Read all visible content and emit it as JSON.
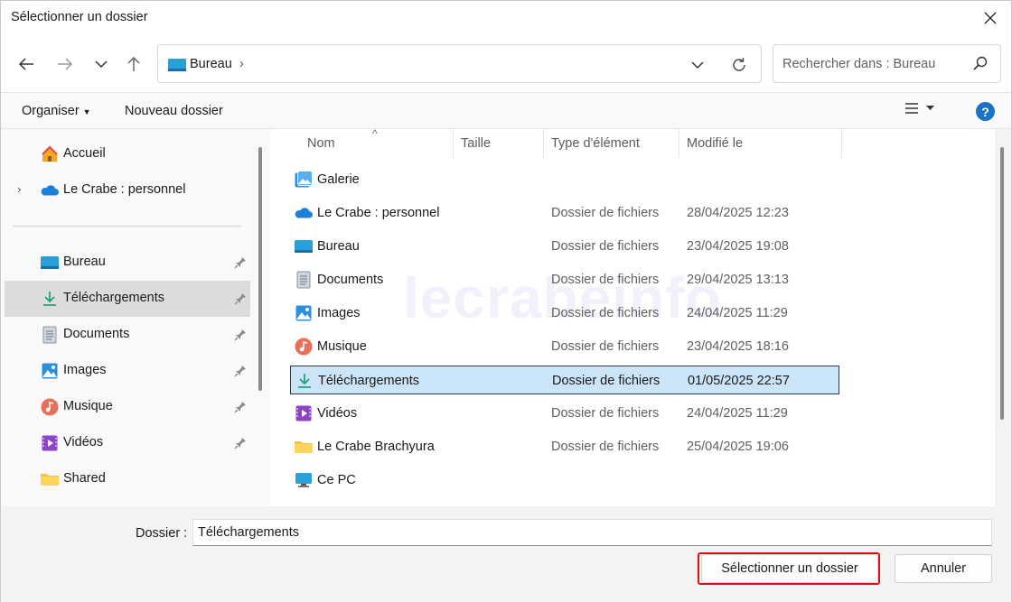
{
  "window": {
    "title": "Sélectionner un dossier"
  },
  "address": {
    "crumb": "Bureau",
    "separator": "›"
  },
  "search": {
    "placeholder": "Rechercher dans : Bureau"
  },
  "toolbar": {
    "organize_label": "Organiser",
    "new_folder_label": "Nouveau dossier",
    "help_label": "?"
  },
  "sidebar": {
    "items": [
      {
        "label": "Accueil",
        "icon": "home-icon"
      },
      {
        "label": "Le Crabe : personnel",
        "icon": "onedrive-icon"
      },
      {
        "label": "Bureau",
        "icon": "desktop-icon",
        "pinned": true
      },
      {
        "label": "Téléchargements",
        "icon": "download-icon",
        "pinned": true,
        "selected": true
      },
      {
        "label": "Documents",
        "icon": "documents-icon",
        "pinned": true
      },
      {
        "label": "Images",
        "icon": "pictures-icon",
        "pinned": true
      },
      {
        "label": "Musique",
        "icon": "music-icon",
        "pinned": true
      },
      {
        "label": "Vidéos",
        "icon": "videos-icon",
        "pinned": true
      },
      {
        "label": "Shared",
        "icon": "folder-icon"
      }
    ]
  },
  "columns": {
    "name": "Nom",
    "size": "Taille",
    "type": "Type d'élément",
    "modified": "Modifié le"
  },
  "files": [
    {
      "name": "Galerie",
      "type": "",
      "modified": "",
      "icon": "gallery-icon"
    },
    {
      "name": "Le Crabe : personnel",
      "type": "Dossier de fichiers",
      "modified": "28/04/2025 12:23",
      "icon": "onedrive-icon"
    },
    {
      "name": "Bureau",
      "type": "Dossier de fichiers",
      "modified": "23/04/2025 19:08",
      "icon": "desktop-icon"
    },
    {
      "name": "Documents",
      "type": "Dossier de fichiers",
      "modified": "29/04/2025 13:13",
      "icon": "documents-icon"
    },
    {
      "name": "Images",
      "type": "Dossier de fichiers",
      "modified": "24/04/2025 11:29",
      "icon": "pictures-icon"
    },
    {
      "name": "Musique",
      "type": "Dossier de fichiers",
      "modified": "23/04/2025 18:16",
      "icon": "music-icon"
    },
    {
      "name": "Téléchargements",
      "type": "Dossier de fichiers",
      "modified": "01/05/2025 22:57",
      "icon": "download-icon",
      "selected": true
    },
    {
      "name": "Vidéos",
      "type": "Dossier de fichiers",
      "modified": "24/04/2025 11:29",
      "icon": "videos-icon"
    },
    {
      "name": "Le Crabe Brachyura",
      "type": "Dossier de fichiers",
      "modified": "25/04/2025 19:06",
      "icon": "folder-icon"
    },
    {
      "name": "Ce PC",
      "type": "",
      "modified": "",
      "icon": "computer-icon"
    }
  ],
  "watermark": "lecrabeinfo",
  "footer": {
    "folder_label": "Dossier :",
    "folder_value": "Téléchargements",
    "select_button": "Sélectionner un dossier",
    "cancel_button": "Annuler"
  },
  "colors": {
    "accent": "#1b72c6",
    "selection": "#cce4f7",
    "highlight": "#e01010"
  }
}
